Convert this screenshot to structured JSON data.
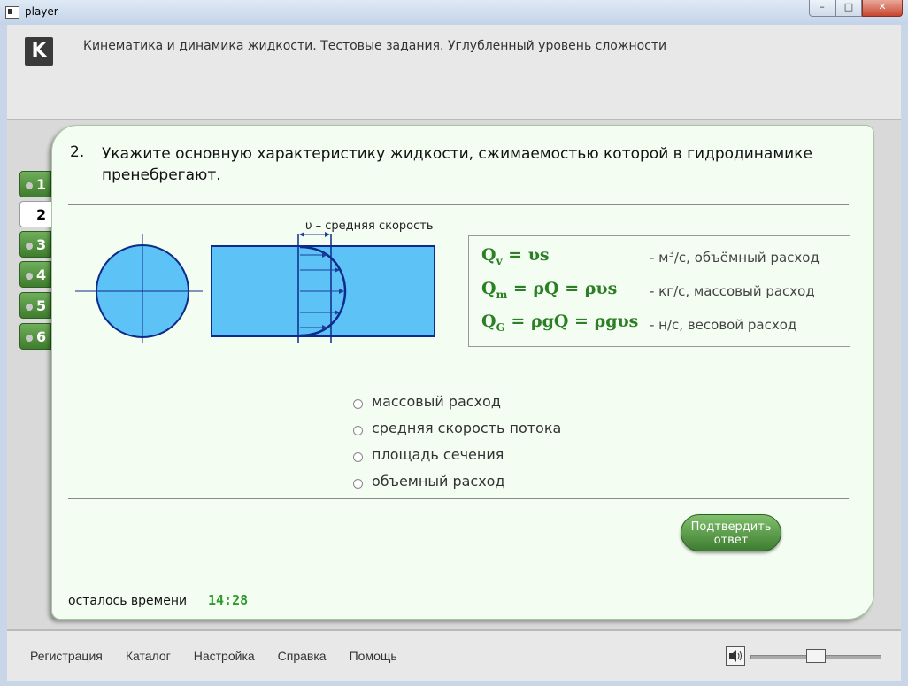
{
  "window": {
    "title": "player",
    "min": "–",
    "max": "□",
    "close": "✕"
  },
  "header": {
    "logo": "K",
    "course_title": "Кинематика и динамика жидкости. Тестовые задания. Углубленный уровень сложности"
  },
  "tabs": [
    {
      "label": "1",
      "active": false
    },
    {
      "label": "2",
      "active": true
    },
    {
      "label": "3",
      "active": false
    },
    {
      "label": "4",
      "active": false
    },
    {
      "label": "5",
      "active": false
    },
    {
      "label": "6",
      "active": false
    }
  ],
  "question": {
    "number": "2.",
    "text": "Укажите основную характеристику жидкости, сжимаемостью которой в гидродинамике пренебрегают."
  },
  "figure": {
    "velocity_label": "υ – средняя скорость",
    "fill_color": "#5dc2f5",
    "stroke_color": "#0e2a8a"
  },
  "formulas": [
    {
      "lhs": "Q",
      "sub": "v",
      "rhs": " = υs",
      "desc_pre": "- м",
      "sup": "3",
      "desc_post": "/с, объёмный расход"
    },
    {
      "lhs": "Q",
      "sub": "m",
      "rhs": " = ρQ = ρυs",
      "desc_pre": "- кг/с, массовый расход",
      "sup": "",
      "desc_post": ""
    },
    {
      "lhs": "Q",
      "sub": "G",
      "rhs": " = ρgQ = ρgυs",
      "desc_pre": "- н/с, весовой расход",
      "sup": "",
      "desc_post": ""
    }
  ],
  "options": [
    "массовый расход",
    "средняя скорость потока",
    "площадь сечения",
    "объемный расход"
  ],
  "confirm": {
    "line1": "Подтвердить",
    "line2": "ответ"
  },
  "timer": {
    "label": "осталось времени",
    "value": "14:28"
  },
  "footer": {
    "menu": [
      "Регистрация",
      "Каталог",
      "Настройка",
      "Справка",
      "Помощь"
    ],
    "volume": 0.5
  },
  "colors": {
    "accent_green": "#3f7d2e",
    "card_bg": "#f3fdf2",
    "formula_green": "#2d7f26"
  }
}
